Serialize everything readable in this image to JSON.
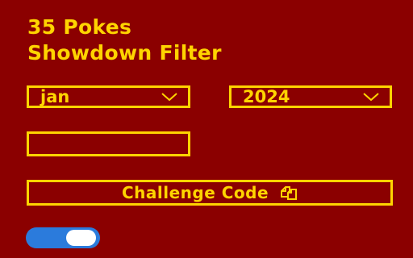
{
  "header": {
    "title_line1": "35 Pokes",
    "title_line2": "Showdown Filter"
  },
  "filters": {
    "month": {
      "selected": "jan",
      "icon": "chevron-down-icon"
    },
    "year": {
      "selected": "2024",
      "icon": "chevron-down-icon"
    }
  },
  "text_input": {
    "value": "",
    "placeholder": ""
  },
  "action": {
    "label": "Challenge Code",
    "icon": "copy-icon"
  },
  "toggle": {
    "state": "on"
  },
  "colors": {
    "background": "#8b0000",
    "accent": "#ffd400",
    "toggle_track": "#2b7bdc",
    "toggle_knob": "#ffffff"
  }
}
